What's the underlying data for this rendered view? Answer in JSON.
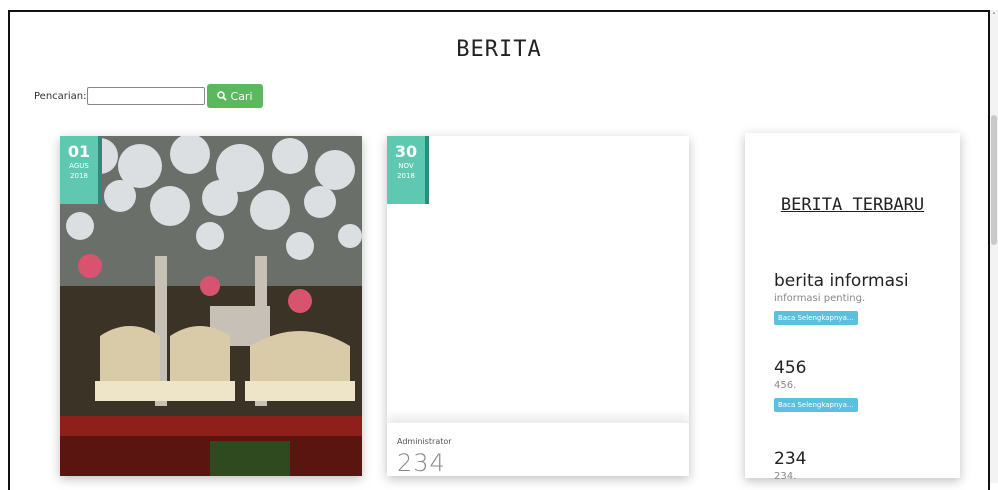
{
  "page": {
    "title": "BERITA"
  },
  "search": {
    "label": "Pencarian:",
    "value": "",
    "button_label": "Cari"
  },
  "posts": [
    {
      "day": "01",
      "month": "AGUS",
      "year": "2018"
    },
    {
      "day": "30",
      "month": "NOV",
      "year": "2018",
      "author": "Administrator",
      "title_partial": "234"
    }
  ],
  "sidebar": {
    "heading": "BERITA TERBARU",
    "items": [
      {
        "title": "berita informasi",
        "desc": "informasi penting.",
        "button": "Baca Selengkapnya..."
      },
      {
        "title": "456",
        "desc": "456.",
        "button": "Baca Selengkapnya..."
      },
      {
        "title": "234",
        "desc": "234."
      }
    ]
  },
  "colors": {
    "date_badge": "#5fc8b0",
    "date_badge_border": "#2e8b7b",
    "search_button": "#5cb85c",
    "read_button": "#5bc0de"
  }
}
